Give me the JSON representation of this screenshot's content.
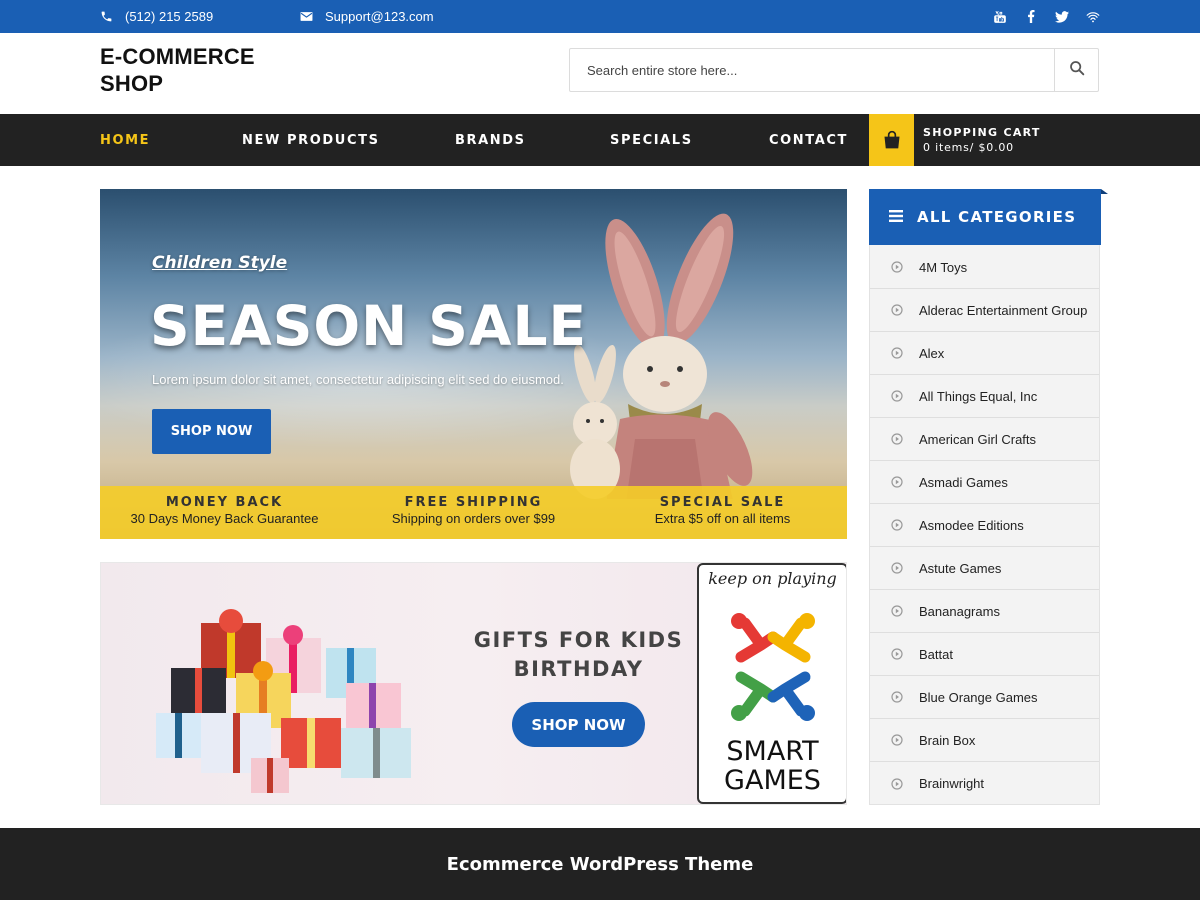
{
  "topbar": {
    "phone": "(512) 215 2589",
    "email": "Support@123.com",
    "social": [
      "youtube-icon",
      "facebook-icon",
      "twitter-icon",
      "wifi-icon"
    ],
    "bg_color": "#1a5fb4"
  },
  "header": {
    "logo_line1": "E-COMMERCE",
    "logo_line2": "SHOP",
    "search_placeholder": "Search entire store here..."
  },
  "nav": {
    "items": [
      "HOME",
      "NEW PRODUCTS",
      "BRANDS",
      "SPECIALS",
      "CONTACT"
    ],
    "active": "HOME",
    "active_color": "#f5c518",
    "cart_title": "SHOPPING CART",
    "cart_summary": "0 items/ $0.00"
  },
  "hero": {
    "subtitle": "Children Style",
    "title": "SEASON SALE",
    "description": "Lorem ipsum dolor sit amet, consectetur adipiscing elit sed do eiusmod.",
    "button": "SHOP NOW",
    "features": [
      {
        "title": "MONEY BACK",
        "text": "30 Days Money Back Guarantee"
      },
      {
        "title": "FREE SHIPPING",
        "text": "Shipping on orders over $99"
      },
      {
        "title": "SPECIAL SALE",
        "text": "Extra $5 off on all items"
      }
    ]
  },
  "promo": {
    "title_line1": "GIFTS FOR KIDS",
    "title_line2": "BIRTHDAY",
    "button": "SHOP NOW",
    "brand_tagline": "keep on playing",
    "brand_name_line1": "SMART",
    "brand_name_line2": "GAMES"
  },
  "sidebar": {
    "title": "ALL CATEGORIES",
    "categories": [
      "4M Toys",
      "Alderac Entertainment Group",
      "Alex",
      "All Things Equal, Inc",
      "American Girl Crafts",
      "Asmadi Games",
      "Asmodee Editions",
      "Astute Games",
      "Bananagrams",
      "Battat",
      "Blue Orange Games",
      "Brain Box",
      "Brainwright"
    ]
  },
  "footer": {
    "text": "Ecommerce WordPress Theme"
  }
}
